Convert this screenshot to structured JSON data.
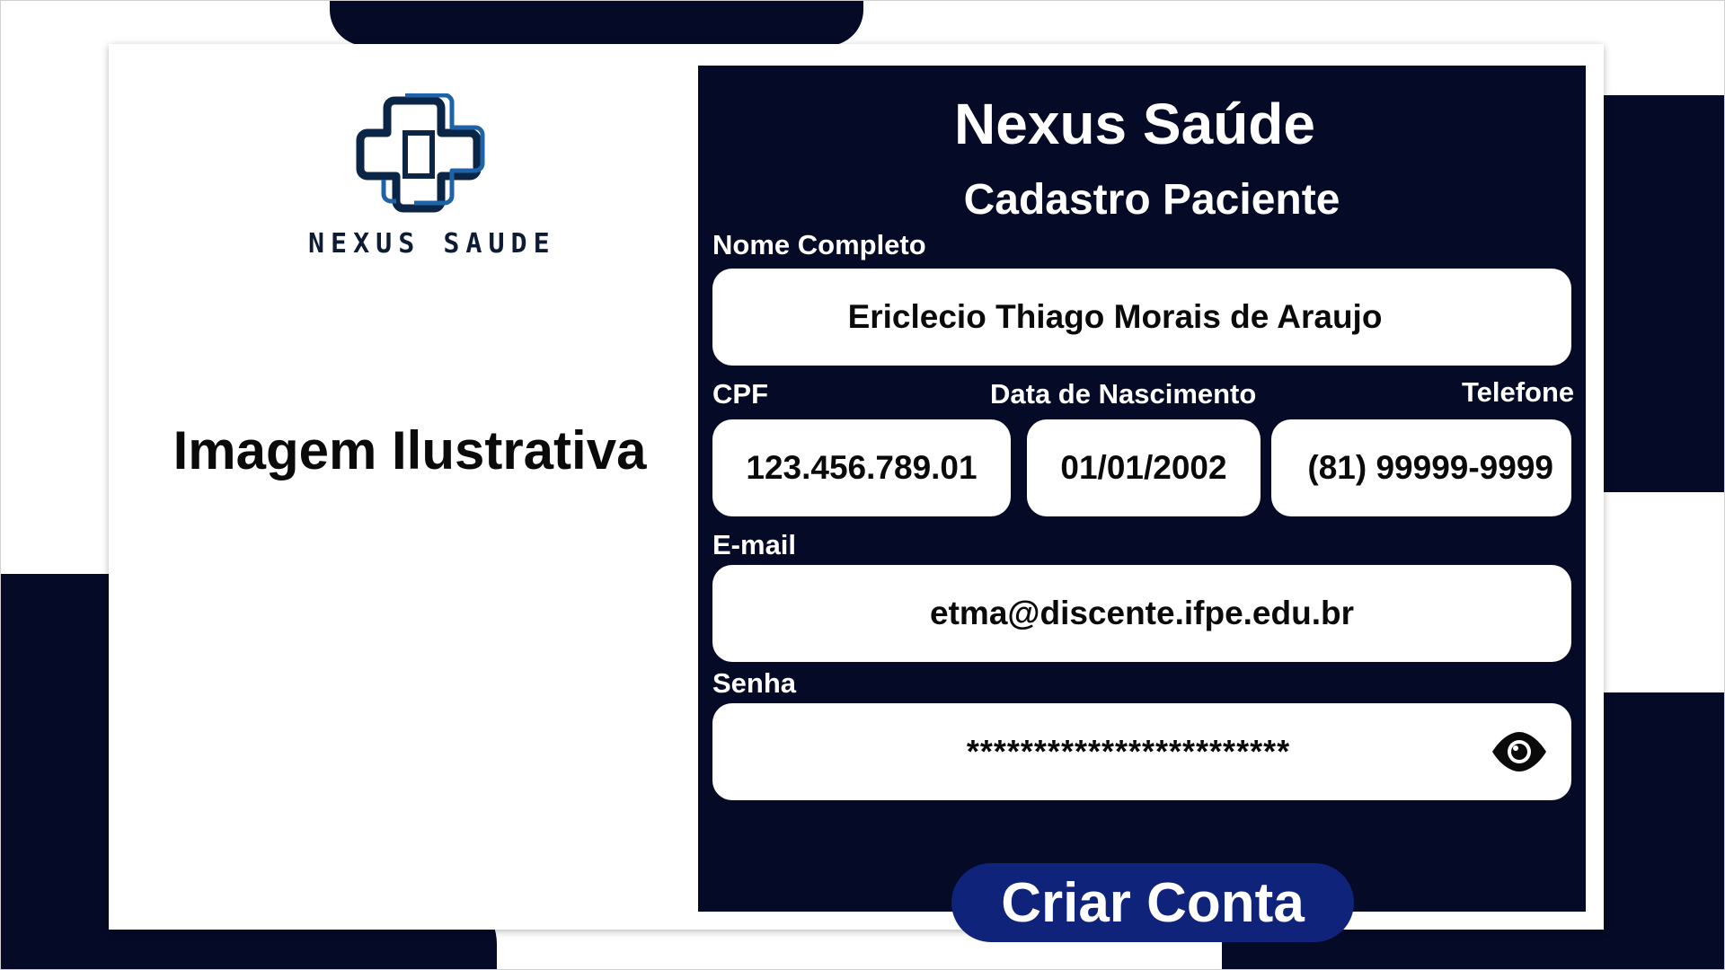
{
  "brand": {
    "logo_text": "NEXUS SAUDE",
    "logo_icon": "medical-cross-logo-icon",
    "primary_color": "#050a26",
    "accent_color": "#10237a"
  },
  "left_panel": {
    "illustration_caption": "Imagem Ilustrativa"
  },
  "form": {
    "title": "Nexus Saúde",
    "subtitle": "Cadastro Paciente",
    "fields": {
      "name": {
        "label": "Nome Completo",
        "value": "Ericlecio Thiago Morais de Araujo"
      },
      "cpf": {
        "label": "CPF",
        "value": "123.456.789.01"
      },
      "birthdate": {
        "label": "Data de Nascimento",
        "value": "01/01/2002"
      },
      "phone": {
        "label": "Telefone",
        "value": "(81) 99999-9999"
      },
      "email": {
        "label": "E-mail",
        "value": "etma@discente.ifpe.edu.br"
      },
      "password": {
        "label": "Senha",
        "value": "************************",
        "toggle_icon": "eye-icon"
      }
    },
    "submit_label": "Criar Conta"
  }
}
